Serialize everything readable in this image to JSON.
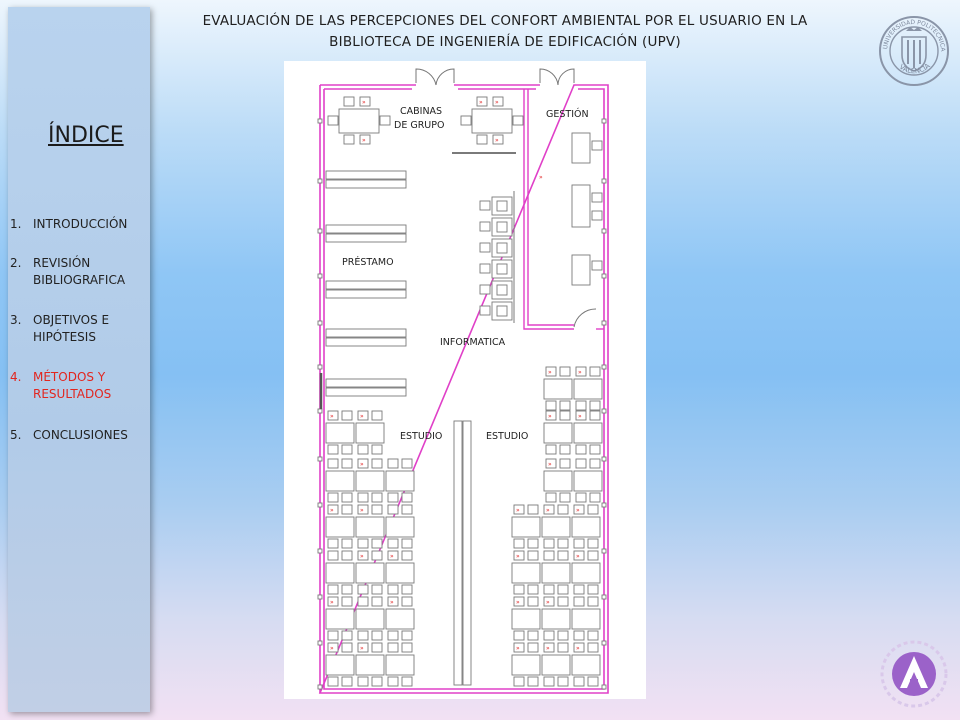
{
  "header": {
    "title_line1": "EVALUACIÓN DE LAS PERCEPCIONES DEL CONFORT AMBIENTAL POR EL USUARIO EN LA",
    "title_line2": "BIBLIOTECA DE INGENIERÍA DE EDIFICACIÓN (UPV)"
  },
  "logo": {
    "text_top": "UNIVERSIDAD POLITECNICA",
    "text_bottom": "VALENCIA"
  },
  "sidebar": {
    "title": "ÍNDICE",
    "items": [
      {
        "num": "1.",
        "label": "INTRODUCCIÓN",
        "active": false
      },
      {
        "num": "2.",
        "label": "REVISIÓN BIBLIOGRAFICA",
        "active": false
      },
      {
        "num": "3.",
        "label": "OBJETIVOS E HIPÓTESIS",
        "active": false
      },
      {
        "num": "4.",
        "label": "MÉTODOS Y RESULTADOS",
        "active": true
      },
      {
        "num": "5.",
        "label": "CONCLUSIONES",
        "active": false
      }
    ]
  },
  "floor_plan": {
    "labels": {
      "group_cabins_1": "CABINAS",
      "group_cabins_2": "DE GRUPO",
      "management": "GESTIÓN",
      "loan": "PRÉSTAMO",
      "it": "INFORMATICA",
      "study_left": "ESTUDIO",
      "study_right": "ESTUDIO"
    },
    "colors": {
      "wall": "#e040c8",
      "line": "#7a7a7a",
      "marker": "#e02020"
    }
  }
}
